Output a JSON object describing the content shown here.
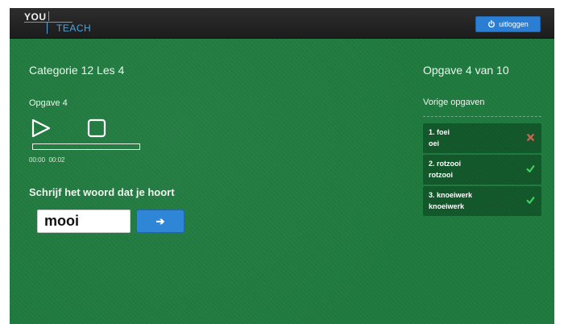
{
  "header": {
    "logo": {
      "line1": "YOU",
      "line2": "TEACH"
    },
    "logout_label": "uitloggen"
  },
  "lesson": {
    "title": "Categorie 12 Les 4",
    "exercise_label": "Opgave 4",
    "time_current": "00:00",
    "time_total": "00:02",
    "playback_progress": 0,
    "question": "Schrijf het woord dat je hoort",
    "answer_value": "mooi",
    "submit_label": "➔"
  },
  "sidebar": {
    "counter": "Opgave 4 van 10",
    "previous_title": "Vorige opgaven",
    "previous": [
      {
        "prompt": "1. foei",
        "answer": "oei",
        "correct": false,
        "mark_color": "#e25a4a"
      },
      {
        "prompt": "2. rotzooi",
        "answer": "rotzooi",
        "correct": true,
        "mark_color": "#3fcf5e"
      },
      {
        "prompt": "3. knoeiwerk",
        "answer": "knoeiwerk",
        "correct": true,
        "mark_color": "#3fcf5e"
      }
    ]
  },
  "colors": {
    "background": "#1f7a3e",
    "topbar": "#232323",
    "accent_blue": "#2f85d6",
    "wrong": "#e25a4a",
    "right": "#3fcf5e"
  }
}
